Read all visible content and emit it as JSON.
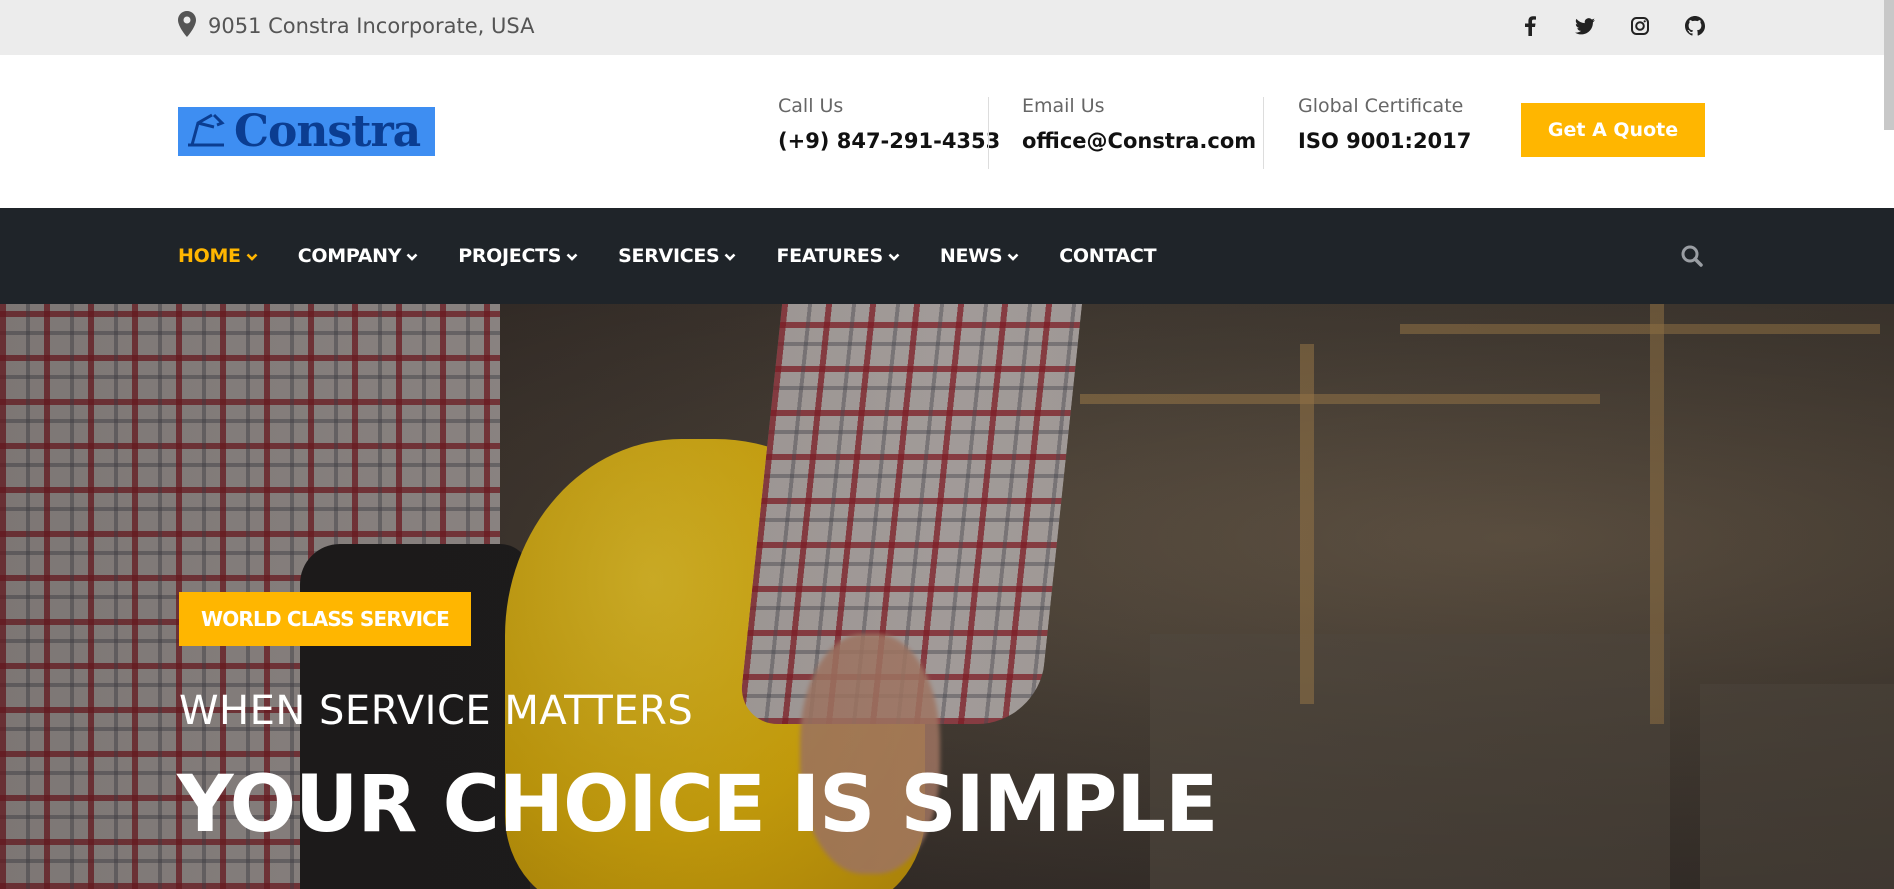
{
  "topbar": {
    "address": "9051 Constra Incorporate, USA",
    "social": [
      {
        "name": "facebook-icon"
      },
      {
        "name": "twitter-icon"
      },
      {
        "name": "instagram-icon"
      },
      {
        "name": "github-icon"
      }
    ]
  },
  "header": {
    "logo_text": "Constra",
    "call": {
      "label": "Call Us",
      "value": "(+9) 847-291-4353"
    },
    "email": {
      "label": "Email Us",
      "value": "office@Constra.com"
    },
    "certificate": {
      "label": "Global Certificate",
      "value": "ISO 9001:2017"
    },
    "quote_button": "Get A Quote"
  },
  "nav": {
    "items": [
      {
        "label": "HOME",
        "active": true,
        "dropdown": true
      },
      {
        "label": "COMPANY",
        "dropdown": true
      },
      {
        "label": "PROJECTS",
        "dropdown": true
      },
      {
        "label": "SERVICES",
        "dropdown": true
      },
      {
        "label": "FEATURES",
        "dropdown": true
      },
      {
        "label": "NEWS",
        "dropdown": true
      },
      {
        "label": "CONTACT",
        "dropdown": false
      }
    ],
    "search_icon": "search-icon"
  },
  "hero": {
    "badge": "WORLD CLASS SERVICE",
    "subtitle": "WHEN SERVICE MATTERS",
    "headline": "YOUR CHOICE IS SIMPLE"
  },
  "colors": {
    "accent": "#ffb600",
    "nav_bg": "#1f2429",
    "topbar_bg": "#ececec"
  }
}
